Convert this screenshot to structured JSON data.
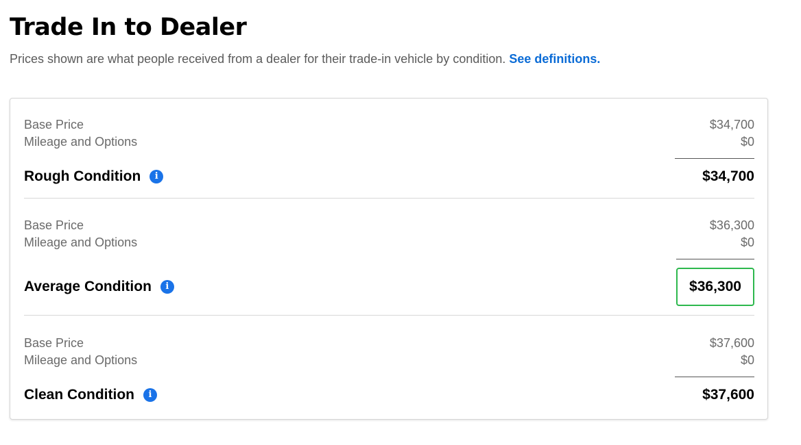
{
  "header": {
    "title": "Trade In to Dealer",
    "subtitle": "Prices shown are what people received from a dealer for their trade-in vehicle by condition.",
    "link_label": "See definitions."
  },
  "conditions": [
    {
      "base_label": "Base Price",
      "base_value": "$34,700",
      "mileage_label": "Mileage and Options",
      "mileage_value": "$0",
      "name": "Rough Condition",
      "total": "$34,700"
    },
    {
      "base_label": "Base Price",
      "base_value": "$36,300",
      "mileage_label": "Mileage and Options",
      "mileage_value": "$0",
      "name": "Average Condition",
      "total": "$36,300",
      "highlighted": true
    },
    {
      "base_label": "Base Price",
      "base_value": "$37,600",
      "mileage_label": "Mileage and Options",
      "mileage_value": "$0",
      "name": "Clean Condition",
      "total": "$37,600"
    }
  ],
  "info_icon_glyph": "i",
  "colors": {
    "link": "#0a6bd6",
    "info_icon": "#1a73e8",
    "highlight_border": "#2db84d"
  }
}
